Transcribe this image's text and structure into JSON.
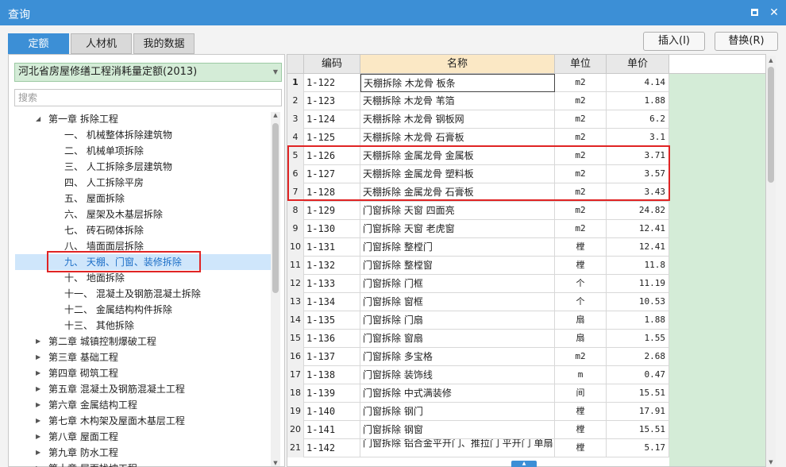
{
  "window": {
    "title": "查询",
    "maximize_icon": "maximize-icon",
    "close_icon": "close-icon",
    "close_glyph": "✕"
  },
  "tabs": [
    {
      "label": "定额",
      "active": true
    },
    {
      "label": "人材机",
      "active": false
    },
    {
      "label": "我的数据",
      "active": false
    }
  ],
  "buttons": {
    "insert": "插入(I)",
    "replace": "替换(R)"
  },
  "left": {
    "quota_library": "河北省房屋修缮工程消耗量定额(2013)",
    "search_placeholder": "搜索",
    "tree": [
      {
        "label": "第一章 拆除工程",
        "level": 0,
        "expanded": true
      },
      {
        "label": "一、 机械整体拆除建筑物",
        "level": 1
      },
      {
        "label": "二、 机械单项拆除",
        "level": 1
      },
      {
        "label": "三、 人工拆除多层建筑物",
        "level": 1
      },
      {
        "label": "四、 人工拆除平房",
        "level": 1
      },
      {
        "label": "五、 屋面拆除",
        "level": 1
      },
      {
        "label": "六、 屋架及木基层拆除",
        "level": 1
      },
      {
        "label": "七、 砖石砌体拆除",
        "level": 1
      },
      {
        "label": "八、 墙面面层拆除",
        "level": 1
      },
      {
        "label": "九、 天棚、门窗、装修拆除",
        "level": 1,
        "selected": true
      },
      {
        "label": "十、 地面拆除",
        "level": 1
      },
      {
        "label": "十一、 混凝土及钢筋混凝土拆除",
        "level": 1
      },
      {
        "label": "十二、 金属结构构件拆除",
        "level": 1
      },
      {
        "label": "十三、 其他拆除",
        "level": 1
      },
      {
        "label": "第二章 城镇控制爆破工程",
        "level": 0,
        "expanded": false
      },
      {
        "label": "第三章 基础工程",
        "level": 0,
        "expanded": false
      },
      {
        "label": "第四章 砌筑工程",
        "level": 0,
        "expanded": false
      },
      {
        "label": "第五章 混凝土及钢筋混凝土工程",
        "level": 0,
        "expanded": false
      },
      {
        "label": "第六章 金属结构工程",
        "level": 0,
        "expanded": false
      },
      {
        "label": "第七章 木构架及屋面木基层工程",
        "level": 0,
        "expanded": false
      },
      {
        "label": "第八章 屋面工程",
        "level": 0,
        "expanded": false
      },
      {
        "label": "第九章 防水工程",
        "level": 0,
        "expanded": false
      },
      {
        "label": "第十章 屋面找坡工程",
        "level": 0,
        "expanded": false
      }
    ]
  },
  "grid": {
    "headers": {
      "code": "编码",
      "name": "名称",
      "unit": "单位",
      "price": "单价"
    },
    "rows": [
      {
        "no": "1",
        "code": "1-122",
        "name": "天棚拆除 木龙骨 板条",
        "unit": "m2",
        "price": "4.14"
      },
      {
        "no": "2",
        "code": "1-123",
        "name": "天棚拆除 木龙骨 苇箔",
        "unit": "m2",
        "price": "1.88"
      },
      {
        "no": "3",
        "code": "1-124",
        "name": "天棚拆除 木龙骨 钢板网",
        "unit": "m2",
        "price": "6.2"
      },
      {
        "no": "4",
        "code": "1-125",
        "name": "天棚拆除 木龙骨 石膏板",
        "unit": "m2",
        "price": "3.1"
      },
      {
        "no": "5",
        "code": "1-126",
        "name": "天棚拆除 金属龙骨 金属板",
        "unit": "m2",
        "price": "3.71"
      },
      {
        "no": "6",
        "code": "1-127",
        "name": "天棚拆除 金属龙骨 塑料板",
        "unit": "m2",
        "price": "3.57"
      },
      {
        "no": "7",
        "code": "1-128",
        "name": "天棚拆除 金属龙骨 石膏板",
        "unit": "m2",
        "price": "3.43"
      },
      {
        "no": "8",
        "code": "1-129",
        "name": "门窗拆除 天窗 四面亮",
        "unit": "m2",
        "price": "24.82"
      },
      {
        "no": "9",
        "code": "1-130",
        "name": "门窗拆除 天窗 老虎窗",
        "unit": "m2",
        "price": "12.41"
      },
      {
        "no": "10",
        "code": "1-131",
        "name": "门窗拆除 整樘门",
        "unit": "樘",
        "price": "12.41"
      },
      {
        "no": "11",
        "code": "1-132",
        "name": "门窗拆除 整樘窗",
        "unit": "樘",
        "price": "11.8"
      },
      {
        "no": "12",
        "code": "1-133",
        "name": "门窗拆除 门框",
        "unit": "个",
        "price": "11.19"
      },
      {
        "no": "13",
        "code": "1-134",
        "name": "门窗拆除 窗框",
        "unit": "个",
        "price": "10.53"
      },
      {
        "no": "14",
        "code": "1-135",
        "name": "门窗拆除 门扇",
        "unit": "扇",
        "price": "1.88"
      },
      {
        "no": "15",
        "code": "1-136",
        "name": "门窗拆除 窗扇",
        "unit": "扇",
        "price": "1.55"
      },
      {
        "no": "16",
        "code": "1-137",
        "name": "门窗拆除 多宝格",
        "unit": "m2",
        "price": "2.68"
      },
      {
        "no": "17",
        "code": "1-138",
        "name": "门窗拆除 装饰线",
        "unit": "m",
        "price": "0.47"
      },
      {
        "no": "18",
        "code": "1-139",
        "name": "门窗拆除 中式满装修",
        "unit": "间",
        "price": "15.51"
      },
      {
        "no": "19",
        "code": "1-140",
        "name": "门窗拆除 钢门",
        "unit": "樘",
        "price": "17.91"
      },
      {
        "no": "20",
        "code": "1-141",
        "name": "门窗拆除 钢窗",
        "unit": "樘",
        "price": "15.51"
      },
      {
        "no": "21",
        "code": "1-142",
        "name": "门窗拆除 铝合金平开门、推拉门 平开门 单扇",
        "unit": "樘",
        "price": "5.17"
      }
    ]
  },
  "colors": {
    "accent": "#3c8fd6",
    "highlight_red": "#e02424",
    "panel_green": "#d4ecd7",
    "header_name": "#fbe8c5"
  }
}
